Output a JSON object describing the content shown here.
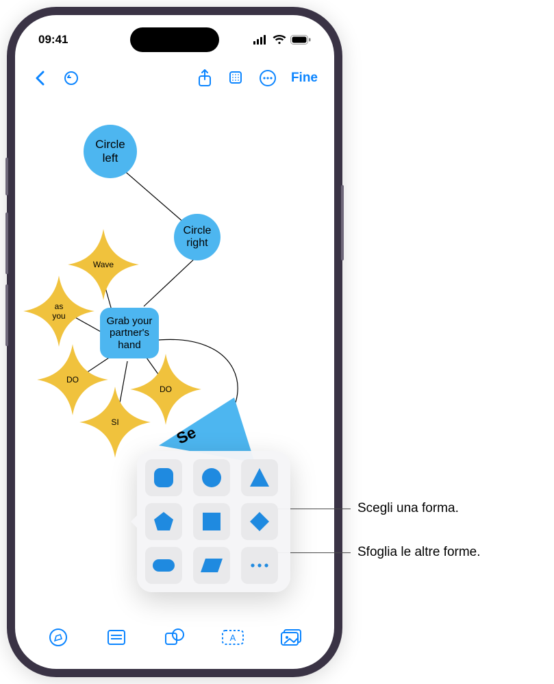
{
  "status": {
    "time": "09:41"
  },
  "toolbar": {
    "done_label": "Fine"
  },
  "nodes": {
    "circle_left": "Circle\nleft",
    "circle_right": "Circle\nright",
    "grab": "Grab your\npartner's\nhand",
    "wave": "Wave",
    "as_you": "as\nyou",
    "do1": "DO",
    "do2": "DO",
    "si": "SI",
    "see": "Se"
  },
  "callouts": {
    "choose_shape": "Scegli una forma.",
    "browse_shapes": "Sfoglia le altre forme."
  }
}
